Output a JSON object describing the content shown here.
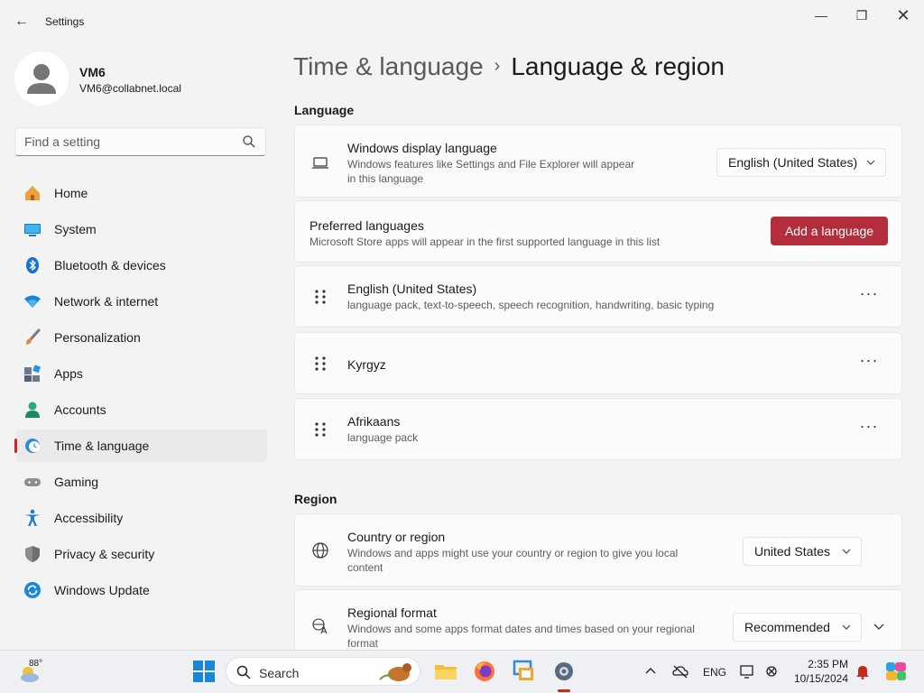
{
  "window": {
    "title": "Settings",
    "back_glyph": "←",
    "minimize_glyph": "—",
    "maximize_glyph": "❐",
    "close_glyph": "✕"
  },
  "user": {
    "name": "VM6",
    "email": "VM6@collabnet.local"
  },
  "search": {
    "placeholder": "Find a setting"
  },
  "sidebar": {
    "items": [
      {
        "label": "Home",
        "icon": "home-icon"
      },
      {
        "label": "System",
        "icon": "system-icon"
      },
      {
        "label": "Bluetooth & devices",
        "icon": "bluetooth-icon"
      },
      {
        "label": "Network & internet",
        "icon": "wifi-icon"
      },
      {
        "label": "Personalization",
        "icon": "brush-icon"
      },
      {
        "label": "Apps",
        "icon": "apps-icon"
      },
      {
        "label": "Accounts",
        "icon": "accounts-icon"
      },
      {
        "label": "Time & language",
        "icon": "time-language-icon",
        "selected": true
      },
      {
        "label": "Gaming",
        "icon": "gamepad-icon"
      },
      {
        "label": "Accessibility",
        "icon": "accessibility-icon"
      },
      {
        "label": "Privacy & security",
        "icon": "shield-icon"
      },
      {
        "label": "Windows Update",
        "icon": "update-icon"
      }
    ]
  },
  "breadcrumb": {
    "parent": "Time & language",
    "separator": "›",
    "current": "Language & region"
  },
  "language_section": {
    "title": "Language",
    "display_language": {
      "title": "Windows display language",
      "description": "Windows features like Settings and File Explorer will appear in this language",
      "value": "English (United States)"
    },
    "preferred": {
      "title": "Preferred languages",
      "description": "Microsoft Store apps will appear in the first supported language in this list",
      "button": "Add a language"
    },
    "languages": [
      {
        "name": "English (United States)",
        "detail": "language pack, text-to-speech, speech recognition, handwriting, basic typing"
      },
      {
        "name": "Kyrgyz",
        "detail": ""
      },
      {
        "name": "Afrikaans",
        "detail": "language pack"
      }
    ],
    "more_glyph": "···"
  },
  "region_section": {
    "title": "Region",
    "country": {
      "title": "Country or region",
      "description": "Windows and apps might use your country or region to give you local content",
      "value": "United States"
    },
    "format": {
      "title": "Regional format",
      "description": "Windows and some apps format dates and times based on your regional format",
      "value": "Recommended"
    }
  },
  "taskbar": {
    "temperature": "88°",
    "search_label": "Search",
    "language": "ENG",
    "time": "2:35 PM",
    "date": "10/15/2024"
  },
  "colors": {
    "accent": "#b42d3c",
    "selection_indicator": "#c42b1c",
    "background": "#f3f3f3",
    "card": "#fbfbfb"
  }
}
